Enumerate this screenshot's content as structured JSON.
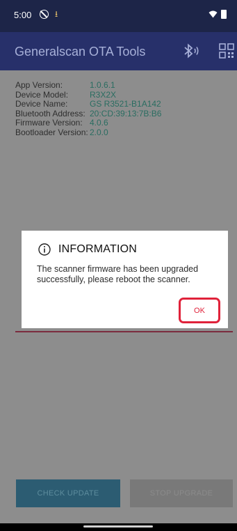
{
  "status_bar": {
    "time": "5:00",
    "icons": [
      "dnd-icon",
      "download-icon",
      "wifi-icon",
      "battery-icon"
    ]
  },
  "app_bar": {
    "title": "Generalscan OTA Tools",
    "actions": [
      "bluetooth-audio-icon",
      "qr-code-icon"
    ]
  },
  "device_info": [
    {
      "label": "App Version:",
      "value": "1.0.6.1"
    },
    {
      "label": "Device Model:",
      "value": "R3X2X"
    },
    {
      "label": "Device Name:",
      "value": "GS R3521-B1A142"
    },
    {
      "label": "Bluetooth Address:",
      "value": "20:CD:39:13:7B:B6"
    },
    {
      "label": "Firmware Version:",
      "value": "4.0.6"
    },
    {
      "label": "Bootloader Version:",
      "value": "2.0.0"
    }
  ],
  "buttons": {
    "check_update": "CHECK UPDATE",
    "stop_upgrade": "STOP UPGRADE"
  },
  "dialog": {
    "title": "INFORMATION",
    "message": "The scanner firmware has been upgraded successfully, please reboot the scanner.",
    "ok_label": "OK"
  },
  "colors": {
    "app_bar": "#27306a",
    "status_bar": "#1d2548",
    "accent": "#e0223a",
    "value_text": "#2a6d61"
  }
}
